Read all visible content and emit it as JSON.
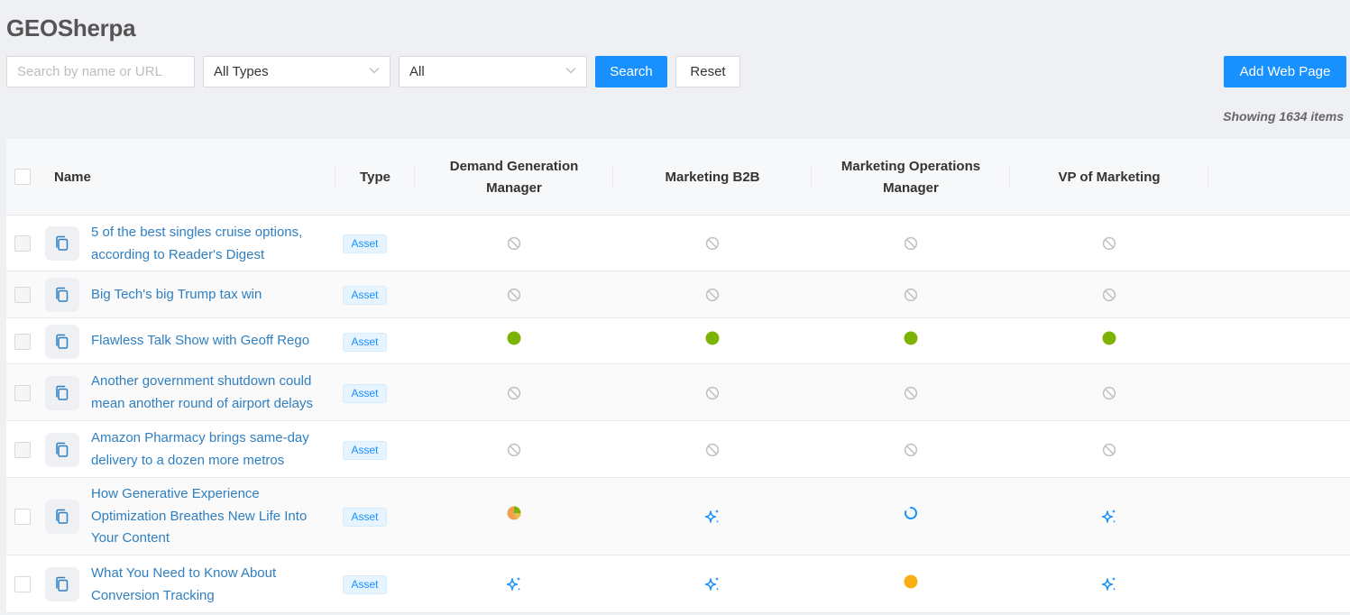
{
  "app": {
    "title": "GEOSherpa"
  },
  "toolbar": {
    "search_placeholder": "Search by name or URL",
    "type_select": "All Types",
    "filter_select": "All",
    "search_label": "Search",
    "reset_label": "Reset",
    "add_label": "Add Web Page"
  },
  "summary": {
    "showing_text": "Showing 1634 items"
  },
  "table": {
    "headers": {
      "name": "Name",
      "type": "Type",
      "personas": [
        "Demand Generation Manager",
        "Marketing B2B",
        "Marketing Operations Manager",
        "VP of Marketing"
      ]
    },
    "rows": [
      {
        "name": "5 of the best singles cruise options, according to Reader's Digest",
        "type": "Asset",
        "status": [
          "na",
          "na",
          "na",
          "na"
        ]
      },
      {
        "name": "Big Tech's big Trump tax win",
        "type": "Asset",
        "status": [
          "na",
          "na",
          "na",
          "na"
        ]
      },
      {
        "name": "Flawless Talk Show with Geoff Rego",
        "type": "Asset",
        "status": [
          "green",
          "green",
          "green",
          "green"
        ]
      },
      {
        "name": "Another government shutdown could mean another round of airport delays",
        "type": "Asset",
        "status": [
          "na",
          "na",
          "na",
          "na"
        ]
      },
      {
        "name": "Amazon Pharmacy brings same-day delivery to a dozen more metros",
        "type": "Asset",
        "status": [
          "na",
          "na",
          "na",
          "na"
        ]
      },
      {
        "name": "How Generative Experience Optimization Breathes New Life Into Your Content",
        "type": "Asset",
        "status": [
          "pie",
          "sparkle",
          "loading",
          "sparkle"
        ]
      },
      {
        "name": "What You Need to Know About Conversion Tracking",
        "type": "Asset",
        "status": [
          "sparkle",
          "sparkle",
          "orange",
          "sparkle"
        ]
      }
    ]
  },
  "colors": {
    "accent": "#1890ff",
    "link": "#2f7fc1",
    "ok": "#7cb305",
    "pending": "#faad14",
    "na": "#bfbfbf"
  }
}
